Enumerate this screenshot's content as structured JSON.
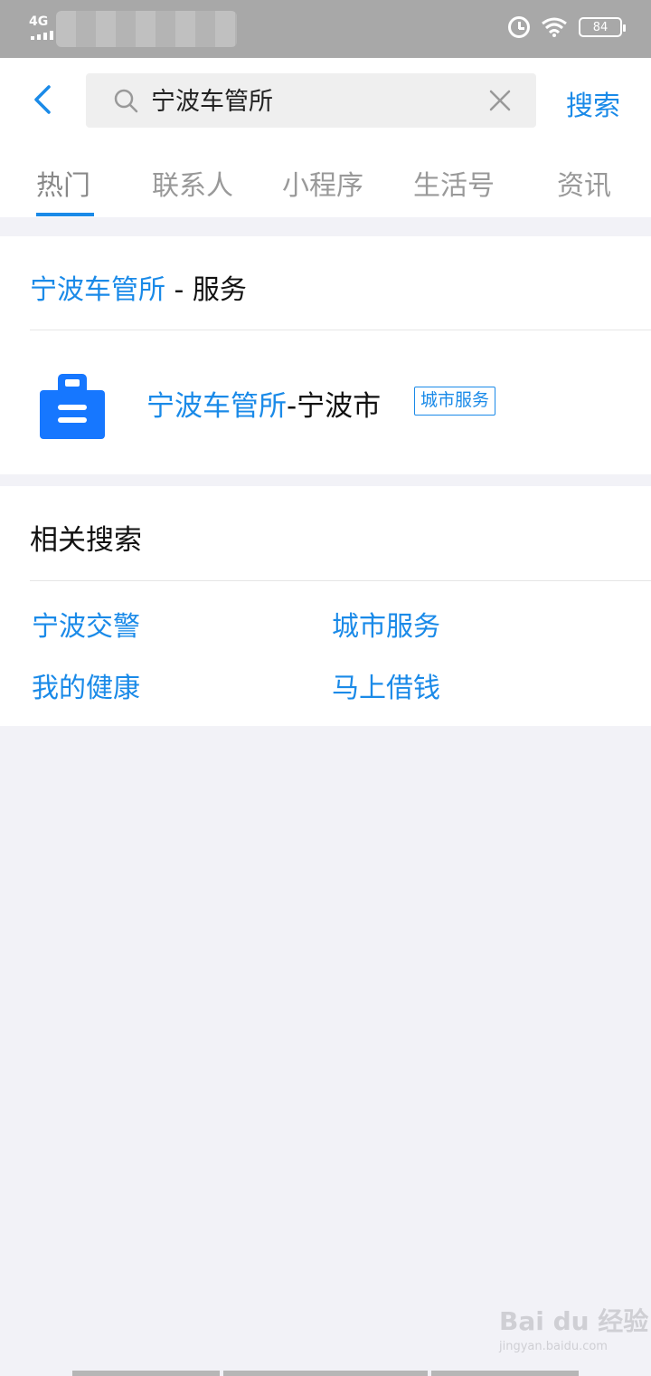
{
  "status_bar": {
    "network": "4G",
    "battery": "84"
  },
  "search": {
    "query": "宁波车管所",
    "button_label": "搜索"
  },
  "tabs": [
    {
      "label": "热门",
      "active": true
    },
    {
      "label": "联系人",
      "active": false
    },
    {
      "label": "小程序",
      "active": false
    },
    {
      "label": "生活号",
      "active": false
    },
    {
      "label": "资讯",
      "active": false
    }
  ],
  "service_section": {
    "title_highlight": "宁波车管所",
    "title_suffix": " - 服务",
    "item": {
      "name_highlight": "宁波车管所",
      "name_suffix": "-宁波市",
      "badge": "城市服务",
      "icon": "service-clipboard-icon"
    }
  },
  "related": {
    "title": "相关搜索",
    "items": [
      "宁波交警",
      "城市服务",
      "我的健康",
      "马上借钱"
    ]
  },
  "watermark": {
    "main": "Bai du 经验",
    "sub": "jingyan.baidu.com"
  },
  "colors": {
    "accent": "#1a8ae8",
    "status_bar": "#a8a8a8",
    "background": "#f2f2f7"
  }
}
